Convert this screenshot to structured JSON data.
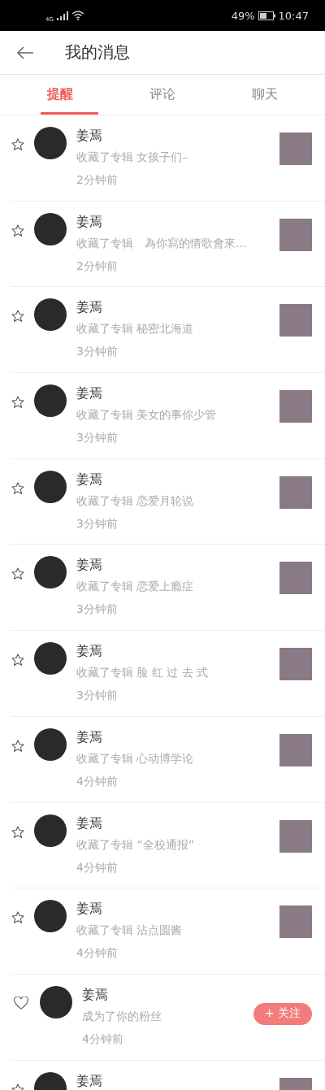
{
  "status_bar": {
    "network": "4G",
    "battery": "49%",
    "time": "10:47"
  },
  "header": {
    "title": "我的消息"
  },
  "tabs": [
    {
      "label": "提醒",
      "selected": true
    },
    {
      "label": "评论",
      "selected": false
    },
    {
      "label": "聊天",
      "selected": false
    }
  ],
  "notifications": [
    {
      "kind": "favorite",
      "name": "姜焉",
      "detail": "收藏了专辑 女孩子们–",
      "time": "2分钟前"
    },
    {
      "kind": "favorite",
      "name": "姜焉",
      "detail": "收藏了专辑　為你寫的情歌會來...",
      "time": "2分钟前"
    },
    {
      "kind": "favorite",
      "name": "姜焉",
      "detail": "收藏了专辑 秘密北海道",
      "time": "3分钟前"
    },
    {
      "kind": "favorite",
      "name": "姜焉",
      "detail": "收藏了专辑 美女的事你少管",
      "time": "3分钟前"
    },
    {
      "kind": "favorite",
      "name": "姜焉",
      "detail": "收藏了专辑 恋爱月轮说",
      "time": "3分钟前"
    },
    {
      "kind": "favorite",
      "name": "姜焉",
      "detail": "收藏了专辑 恋爱上瘾症",
      "time": "3分钟前"
    },
    {
      "kind": "favorite",
      "name": "姜焉",
      "detail": "收藏了专辑 脸 红 过 去 式",
      "time": "3分钟前"
    },
    {
      "kind": "favorite",
      "name": "姜焉",
      "detail": "收藏了专辑 心动博学论",
      "time": "4分钟前"
    },
    {
      "kind": "favorite",
      "name": "姜焉",
      "detail": "收藏了专辑 “全校通报”",
      "time": "4分钟前"
    },
    {
      "kind": "favorite",
      "name": "姜焉",
      "detail": "收藏了专辑 沾点圆酱",
      "time": "4分钟前"
    },
    {
      "kind": "follow",
      "name": "姜焉",
      "detail": "成为了你的粉丝",
      "time": "4分钟前",
      "button": "+ 关注"
    },
    {
      "kind": "favorite",
      "name": "姜焉"
    }
  ]
}
